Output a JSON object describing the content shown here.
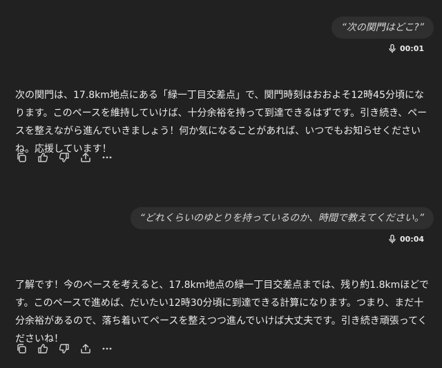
{
  "conversation": {
    "messages": [
      {
        "role": "user",
        "text": "“次の関門はどこ?”",
        "duration": "00:01"
      },
      {
        "role": "assistant",
        "text": "次の関門は、17.8km地点にある「緑一丁目交差点」で、関門時刻はおおよそ12時45分頃になります。このペースを維持していけば、十分余裕を持って到達できるはずです。引き続き、ペースを整えながら進んでいきましょう！何か気になることがあれば、いつでもお知らせくださいね。応援しています！"
      },
      {
        "role": "user",
        "text": "“どれくらいのゆとりを持っているのか、時間で教えてください。”",
        "duration": "00:04"
      },
      {
        "role": "assistant",
        "text": "了解です！今のペースを考えると、17.8km地点の緑一丁目交差点までは、残り約1.8kmほどです。このペースで進めば、だいたい12時30分頃に到達できる計算になります。つまり、まだ十分余裕があるので、落ち着いてペースを整えつつ進んでいけば大丈夫です。引き続き頑張ってくださいね！"
      }
    ]
  },
  "actions": {
    "icons": [
      "copy-icon",
      "thumbs-up-icon",
      "thumbs-down-icon",
      "share-icon",
      "more-icon"
    ]
  }
}
